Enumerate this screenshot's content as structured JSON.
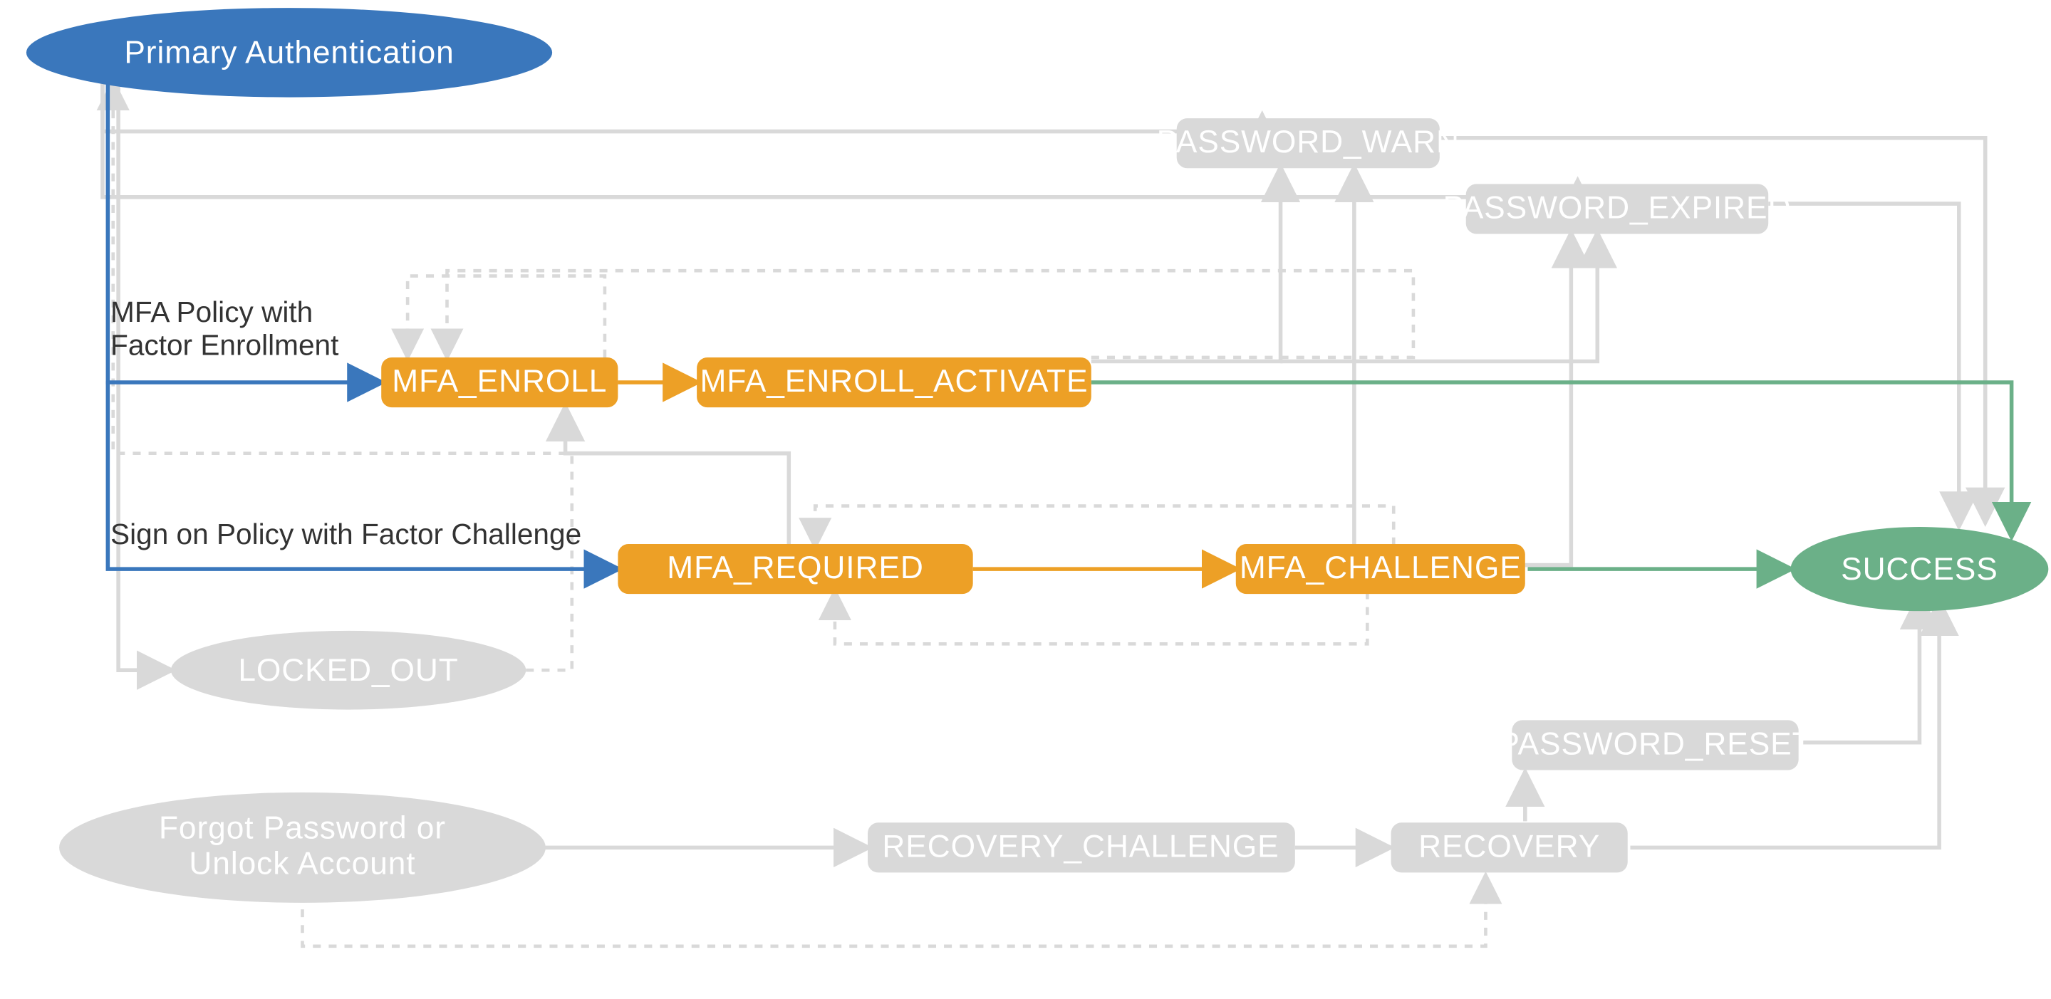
{
  "start": {
    "label": "Primary Authentication"
  },
  "end": {
    "label": "SUCCESS"
  },
  "states": {
    "mfa_enroll": "MFA_ENROLL",
    "mfa_enroll_activate": "MFA_ENROLL_ACTIVATE",
    "mfa_required": "MFA_REQUIRED",
    "mfa_challenge": "MFA_CHALLENGE",
    "password_warn": "PASSWORD_WARN",
    "password_expired": "PASSWORD_EXPIRED",
    "password_reset": "PASSWORD_RESET",
    "locked_out": "LOCKED_OUT",
    "recovery_challenge": "RECOVERY_CHALLENGE",
    "recovery": "RECOVERY"
  },
  "start_alt": {
    "line1": "Forgot Password or",
    "line2": "Unlock Account"
  },
  "annotations": {
    "enroll_line1": "MFA Policy with",
    "enroll_line2": "Factor Enrollment",
    "challenge": "Sign on Policy with Factor Challenge"
  },
  "colors": {
    "blue": "#3a77bc",
    "orange": "#eda026",
    "green": "#6bb088",
    "gray": "#d9d9d9",
    "text": "#333333"
  }
}
